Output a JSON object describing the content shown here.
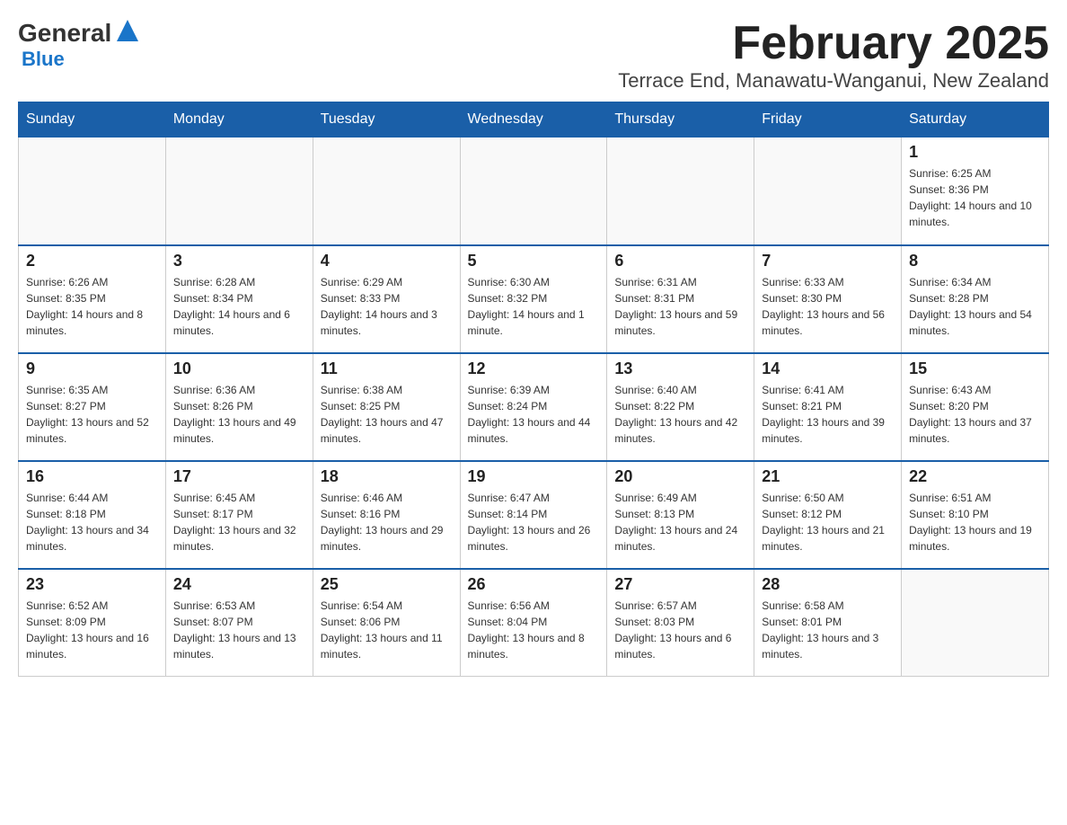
{
  "header": {
    "logo_general": "General",
    "logo_blue": "Blue",
    "title": "February 2025",
    "location": "Terrace End, Manawatu-Wanganui, New Zealand"
  },
  "weekdays": [
    "Sunday",
    "Monday",
    "Tuesday",
    "Wednesday",
    "Thursday",
    "Friday",
    "Saturday"
  ],
  "weeks": [
    [
      {
        "day": "",
        "info": ""
      },
      {
        "day": "",
        "info": ""
      },
      {
        "day": "",
        "info": ""
      },
      {
        "day": "",
        "info": ""
      },
      {
        "day": "",
        "info": ""
      },
      {
        "day": "",
        "info": ""
      },
      {
        "day": "1",
        "info": "Sunrise: 6:25 AM\nSunset: 8:36 PM\nDaylight: 14 hours and 10 minutes."
      }
    ],
    [
      {
        "day": "2",
        "info": "Sunrise: 6:26 AM\nSunset: 8:35 PM\nDaylight: 14 hours and 8 minutes."
      },
      {
        "day": "3",
        "info": "Sunrise: 6:28 AM\nSunset: 8:34 PM\nDaylight: 14 hours and 6 minutes."
      },
      {
        "day": "4",
        "info": "Sunrise: 6:29 AM\nSunset: 8:33 PM\nDaylight: 14 hours and 3 minutes."
      },
      {
        "day": "5",
        "info": "Sunrise: 6:30 AM\nSunset: 8:32 PM\nDaylight: 14 hours and 1 minute."
      },
      {
        "day": "6",
        "info": "Sunrise: 6:31 AM\nSunset: 8:31 PM\nDaylight: 13 hours and 59 minutes."
      },
      {
        "day": "7",
        "info": "Sunrise: 6:33 AM\nSunset: 8:30 PM\nDaylight: 13 hours and 56 minutes."
      },
      {
        "day": "8",
        "info": "Sunrise: 6:34 AM\nSunset: 8:28 PM\nDaylight: 13 hours and 54 minutes."
      }
    ],
    [
      {
        "day": "9",
        "info": "Sunrise: 6:35 AM\nSunset: 8:27 PM\nDaylight: 13 hours and 52 minutes."
      },
      {
        "day": "10",
        "info": "Sunrise: 6:36 AM\nSunset: 8:26 PM\nDaylight: 13 hours and 49 minutes."
      },
      {
        "day": "11",
        "info": "Sunrise: 6:38 AM\nSunset: 8:25 PM\nDaylight: 13 hours and 47 minutes."
      },
      {
        "day": "12",
        "info": "Sunrise: 6:39 AM\nSunset: 8:24 PM\nDaylight: 13 hours and 44 minutes."
      },
      {
        "day": "13",
        "info": "Sunrise: 6:40 AM\nSunset: 8:22 PM\nDaylight: 13 hours and 42 minutes."
      },
      {
        "day": "14",
        "info": "Sunrise: 6:41 AM\nSunset: 8:21 PM\nDaylight: 13 hours and 39 minutes."
      },
      {
        "day": "15",
        "info": "Sunrise: 6:43 AM\nSunset: 8:20 PM\nDaylight: 13 hours and 37 minutes."
      }
    ],
    [
      {
        "day": "16",
        "info": "Sunrise: 6:44 AM\nSunset: 8:18 PM\nDaylight: 13 hours and 34 minutes."
      },
      {
        "day": "17",
        "info": "Sunrise: 6:45 AM\nSunset: 8:17 PM\nDaylight: 13 hours and 32 minutes."
      },
      {
        "day": "18",
        "info": "Sunrise: 6:46 AM\nSunset: 8:16 PM\nDaylight: 13 hours and 29 minutes."
      },
      {
        "day": "19",
        "info": "Sunrise: 6:47 AM\nSunset: 8:14 PM\nDaylight: 13 hours and 26 minutes."
      },
      {
        "day": "20",
        "info": "Sunrise: 6:49 AM\nSunset: 8:13 PM\nDaylight: 13 hours and 24 minutes."
      },
      {
        "day": "21",
        "info": "Sunrise: 6:50 AM\nSunset: 8:12 PM\nDaylight: 13 hours and 21 minutes."
      },
      {
        "day": "22",
        "info": "Sunrise: 6:51 AM\nSunset: 8:10 PM\nDaylight: 13 hours and 19 minutes."
      }
    ],
    [
      {
        "day": "23",
        "info": "Sunrise: 6:52 AM\nSunset: 8:09 PM\nDaylight: 13 hours and 16 minutes."
      },
      {
        "day": "24",
        "info": "Sunrise: 6:53 AM\nSunset: 8:07 PM\nDaylight: 13 hours and 13 minutes."
      },
      {
        "day": "25",
        "info": "Sunrise: 6:54 AM\nSunset: 8:06 PM\nDaylight: 13 hours and 11 minutes."
      },
      {
        "day": "26",
        "info": "Sunrise: 6:56 AM\nSunset: 8:04 PM\nDaylight: 13 hours and 8 minutes."
      },
      {
        "day": "27",
        "info": "Sunrise: 6:57 AM\nSunset: 8:03 PM\nDaylight: 13 hours and 6 minutes."
      },
      {
        "day": "28",
        "info": "Sunrise: 6:58 AM\nSunset: 8:01 PM\nDaylight: 13 hours and 3 minutes."
      },
      {
        "day": "",
        "info": ""
      }
    ]
  ]
}
